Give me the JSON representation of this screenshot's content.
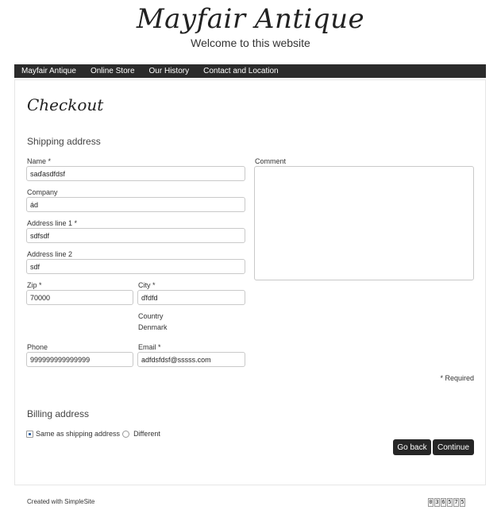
{
  "site": {
    "brand": "Mayfair Antique",
    "tagline": "Welcome to this website"
  },
  "nav": {
    "items": [
      {
        "label": "Mayfair Antique"
      },
      {
        "label": "Online Store"
      },
      {
        "label": "Our History"
      },
      {
        "label": "Contact and Location"
      }
    ]
  },
  "page": {
    "title": "Checkout",
    "shipping_title": "Shipping address",
    "billing_title": "Billing address",
    "required_note": "* Required"
  },
  "form": {
    "name": {
      "label": "Name *",
      "value": "saďasdfdsf"
    },
    "company": {
      "label": "Company",
      "value": "ád"
    },
    "address1": {
      "label": "Address line 1 *",
      "value": "sdfsdf"
    },
    "address2": {
      "label": "Address line 2",
      "value": "sdf"
    },
    "zip": {
      "label": "Zip *",
      "value": "70000"
    },
    "city": {
      "label": "City *",
      "value": "ďfdfd"
    },
    "country": {
      "label": "Country",
      "value": "Denmark"
    },
    "phone": {
      "label": "Phone",
      "value": "999999999999999"
    },
    "email": {
      "label": "Email *",
      "value": "adfdsfdsf@sssss.com"
    },
    "comment": {
      "label": "Comment",
      "value": ""
    }
  },
  "billing": {
    "same_label": "Same as shipping address",
    "different_label": "Different",
    "selected": "same"
  },
  "buttons": {
    "back": "Go back",
    "continue": "Continue"
  },
  "footer": {
    "credit": "Created with SimpleSite",
    "counter_digits": [
      "0",
      "3",
      "6",
      "5",
      "7",
      "5"
    ]
  },
  "colors": {
    "nav_bg": "#2b2b2b",
    "button_bg": "#262626",
    "radio_accent": "#3a6aa8"
  }
}
